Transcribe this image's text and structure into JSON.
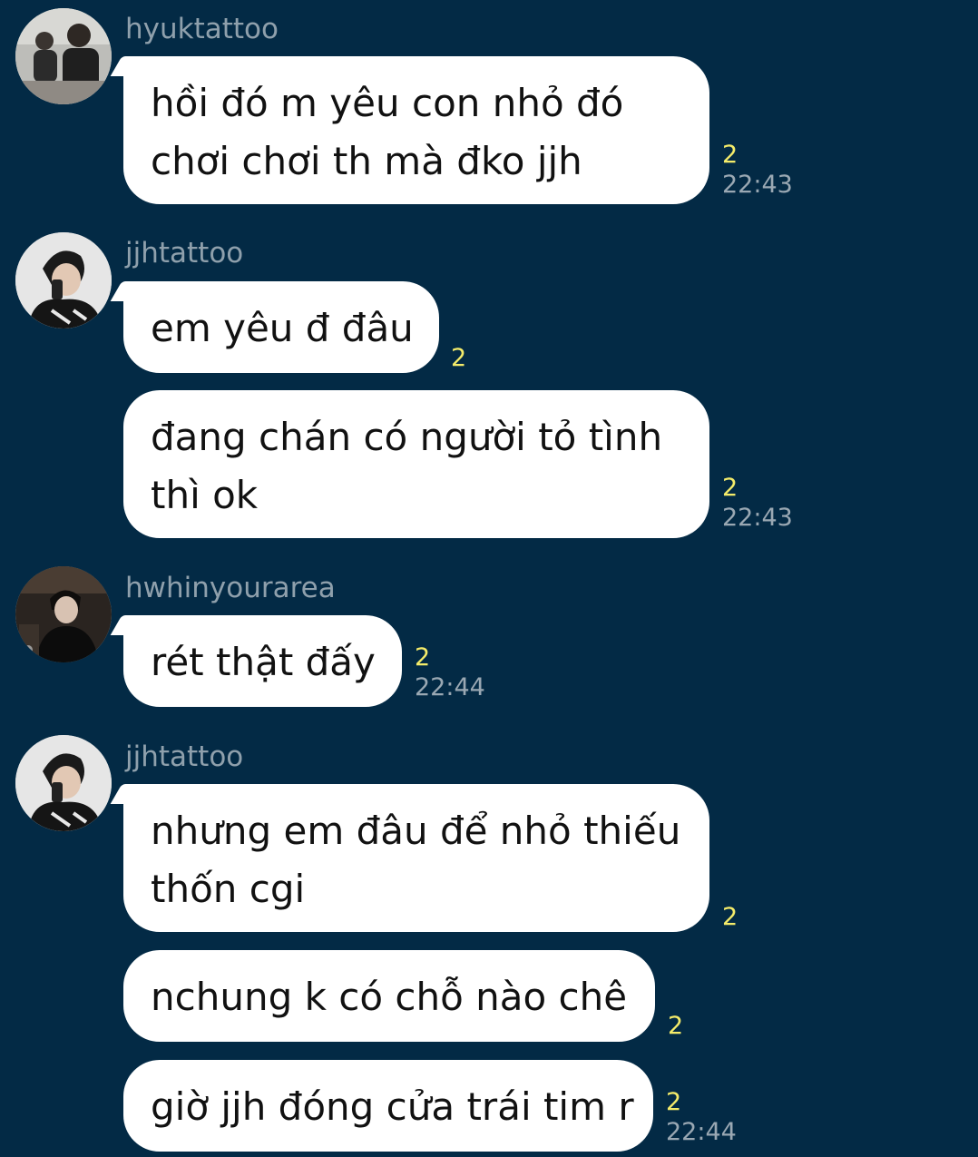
{
  "chat": {
    "groups": [
      {
        "sender": "hyuktattoo",
        "avatar": "profile-photo-hyuktattoo",
        "messages": [
          {
            "lines": [
              "hồi đó m yêu con nhỏ đó",
              "chơi chơi th mà đko jjh"
            ],
            "read_count": "2",
            "time": "22:43"
          }
        ]
      },
      {
        "sender": "jjhtattoo",
        "avatar": "profile-photo-jjhtattoo",
        "messages": [
          {
            "lines": [
              "em yêu đ đâu"
            ],
            "read_count": "2",
            "time": ""
          },
          {
            "lines": [
              "đang chán có người tỏ tình",
              "thì ok"
            ],
            "read_count": "2",
            "time": "22:43"
          }
        ]
      },
      {
        "sender": "hwhinyourarea",
        "avatar": "profile-photo-hwhinyourarea",
        "messages": [
          {
            "lines": [
              "rét thật đấy"
            ],
            "read_count": "2",
            "time": "22:44"
          }
        ]
      },
      {
        "sender": "jjhtattoo",
        "avatar": "profile-photo-jjhtattoo",
        "messages": [
          {
            "lines": [
              "nhưng em đâu để nhỏ thiếu",
              "thốn cgi"
            ],
            "read_count": "2",
            "time": ""
          },
          {
            "lines": [
              "nchung k có chỗ nào chê"
            ],
            "read_count": "2",
            "time": ""
          },
          {
            "lines": [
              "giờ jjh đóng cửa trái tim r"
            ],
            "read_count": "2",
            "time": "22:44"
          }
        ]
      }
    ]
  },
  "colors": {
    "background": "#032a45",
    "bubble": "#ffffff",
    "read_count": "#f5ec6a",
    "meta_text": "#9aa8b3"
  }
}
